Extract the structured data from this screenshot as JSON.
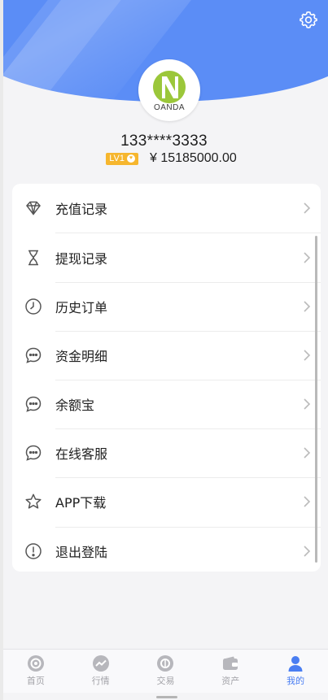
{
  "colors": {
    "accent": "#4a7ef2",
    "header_bg": "#5b8df6",
    "badge": "#f6b62e",
    "tab_inactive": "#a3a3a8",
    "logo_green": "#9bc73a"
  },
  "profile": {
    "logo_text": "OANDA",
    "username": "133****3333",
    "level": "LV1",
    "balance": "¥ 15185000.00"
  },
  "menu": {
    "items": [
      {
        "label": "充值记录",
        "icon": "diamond-icon"
      },
      {
        "label": "提现记录",
        "icon": "hourglass-icon"
      },
      {
        "label": "历史订单",
        "icon": "clock-icon"
      },
      {
        "label": "资金明细",
        "icon": "chat-icon"
      },
      {
        "label": "余额宝",
        "icon": "chat-icon"
      },
      {
        "label": "在线客服",
        "icon": "chat-icon"
      },
      {
        "label": "APP下载",
        "icon": "star-icon"
      },
      {
        "label": "退出登陆",
        "icon": "exclamation-icon"
      }
    ]
  },
  "tabbar": {
    "tabs": [
      {
        "label": "首页",
        "icon": "home-icon",
        "active": false
      },
      {
        "label": "行情",
        "icon": "chart-icon",
        "active": false
      },
      {
        "label": "交易",
        "icon": "trade-icon",
        "active": false
      },
      {
        "label": "资产",
        "icon": "wallet-icon",
        "active": false
      },
      {
        "label": "我的",
        "icon": "user-icon",
        "active": true
      }
    ]
  }
}
